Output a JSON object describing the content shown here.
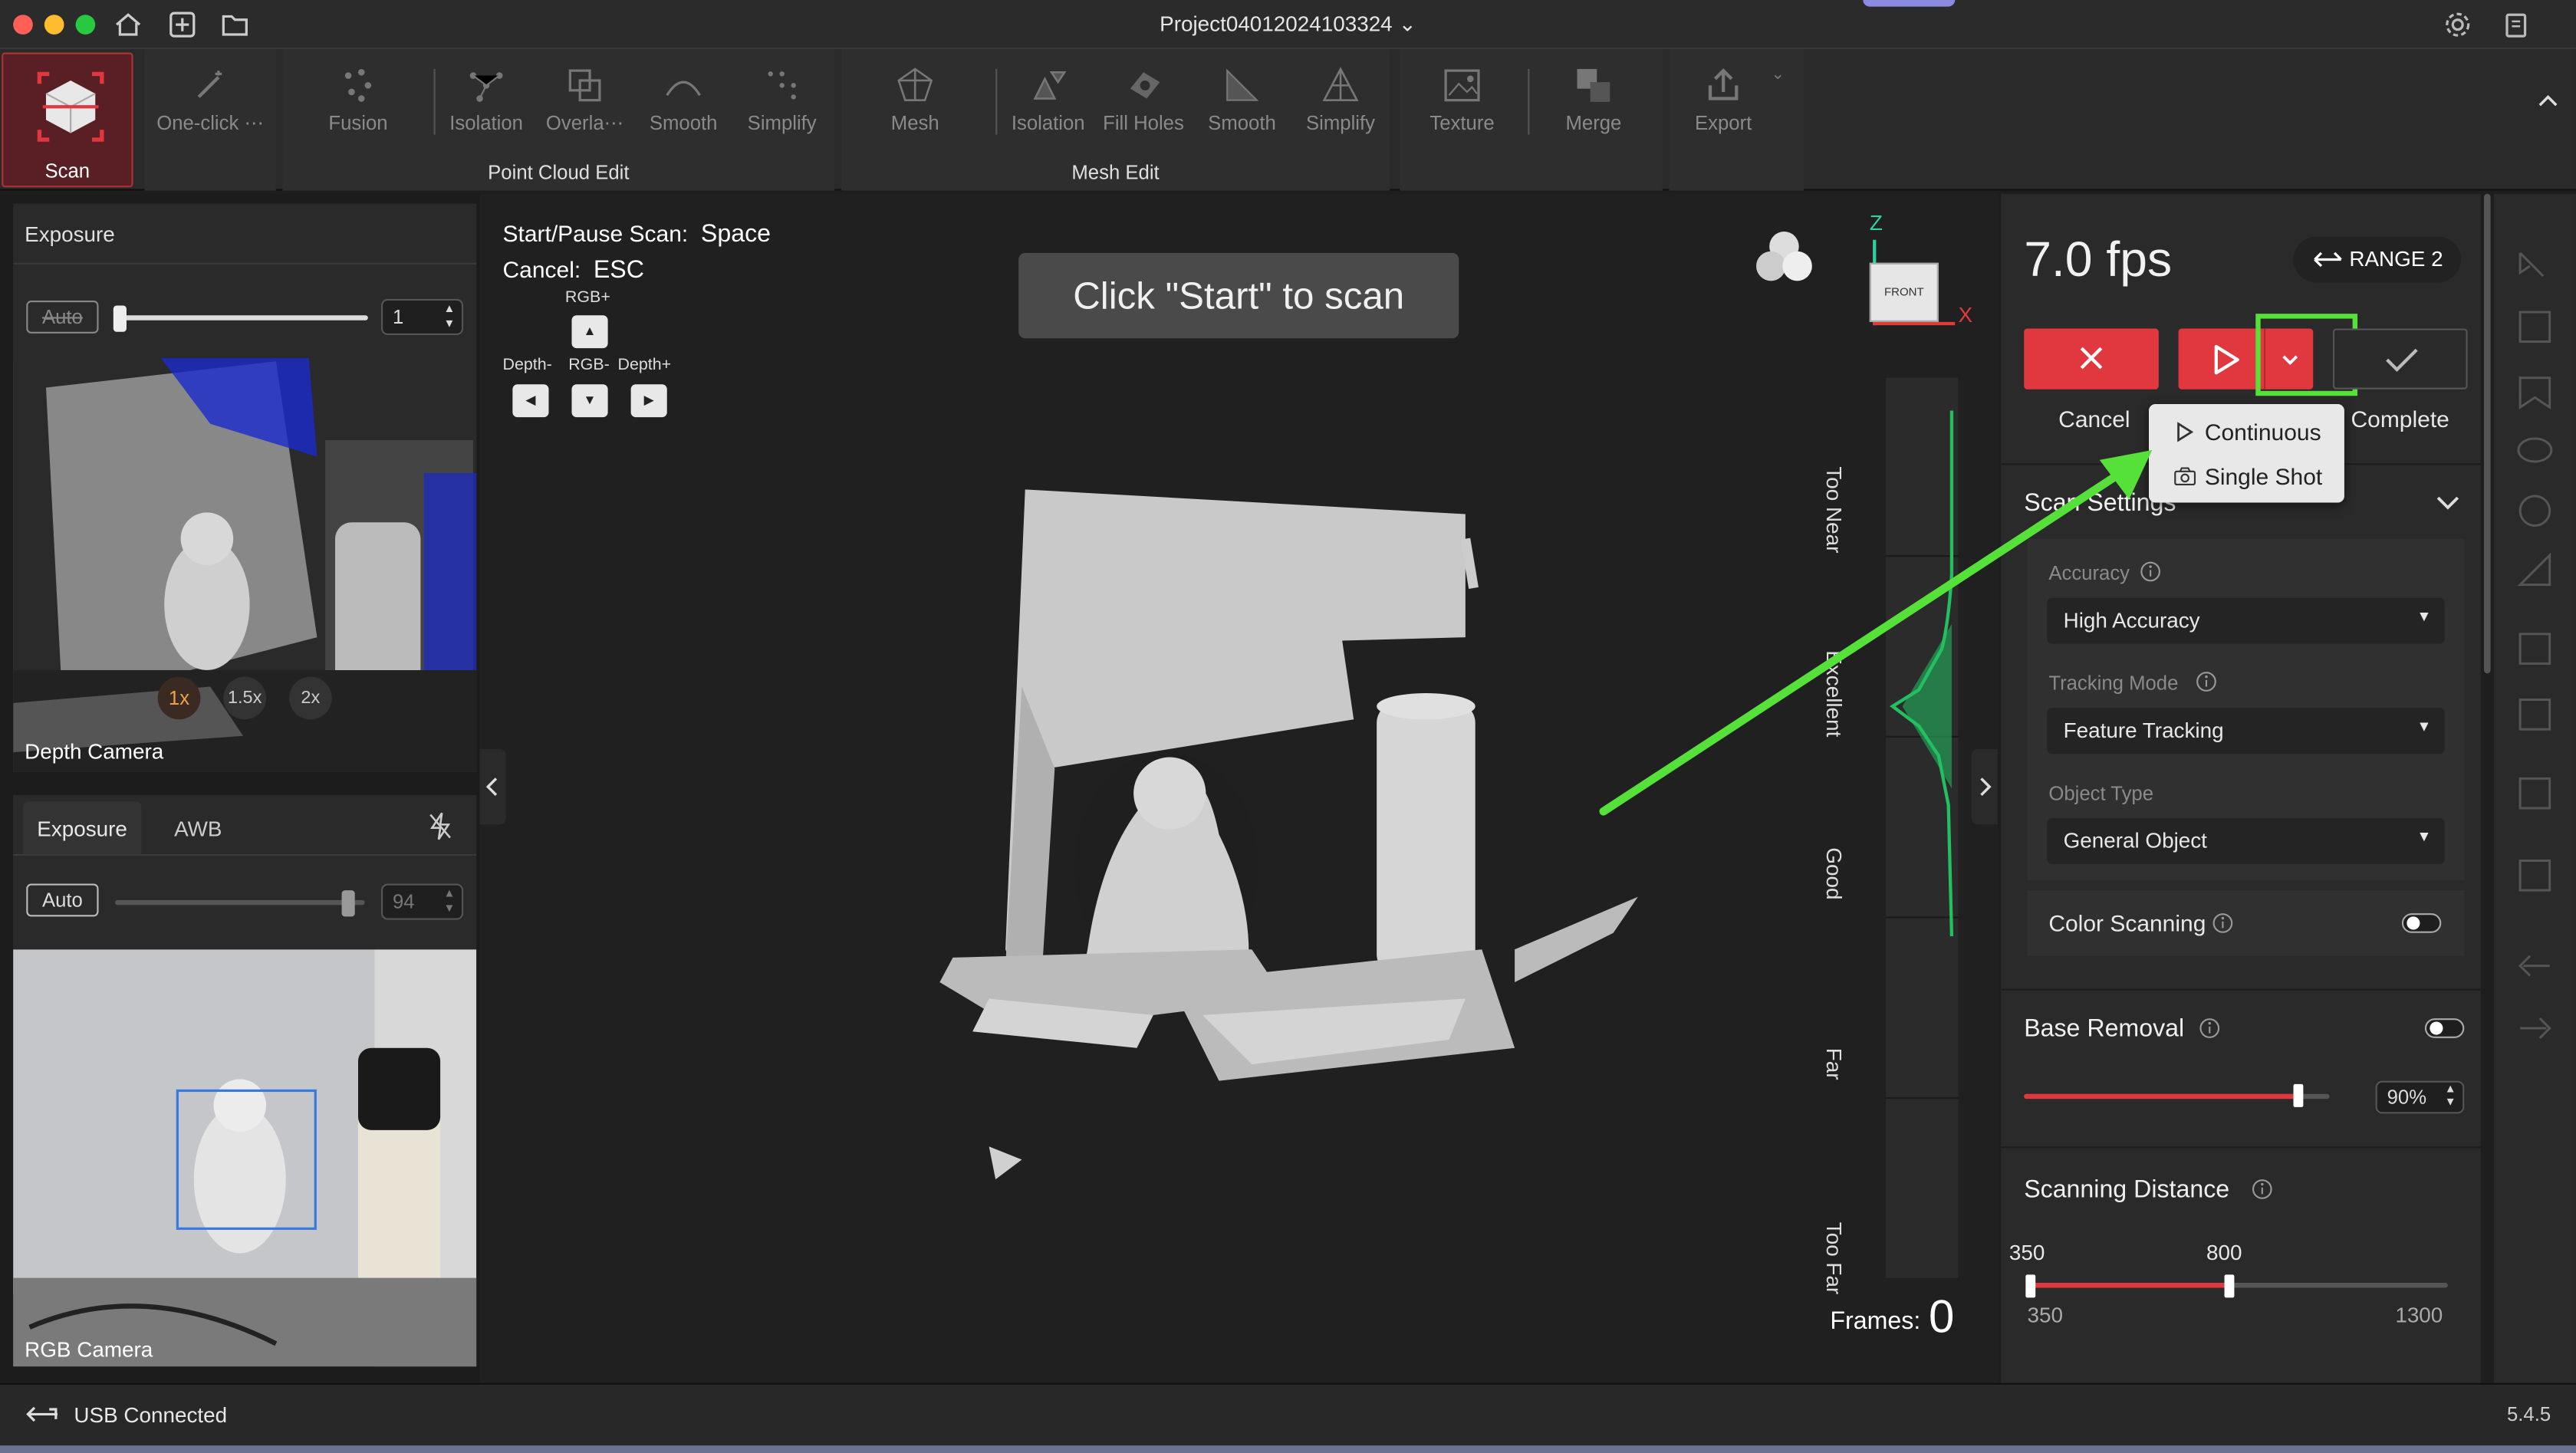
{
  "window": {
    "title": "Project04012024103324"
  },
  "toolbar": {
    "scan": "Scan",
    "oneclick": "One-click ⋯",
    "pc_tools": [
      "Fusion",
      "Isolation",
      "Overla⋯",
      "Smooth",
      "Simplify"
    ],
    "pc_group": "Point Cloud Edit",
    "mesh_tools": [
      "Mesh",
      "Isolation",
      "Fill Holes",
      "Smooth",
      "Simplify"
    ],
    "mesh_group": "Mesh Edit",
    "texture": "Texture",
    "merge": "Merge",
    "export": "Export"
  },
  "left": {
    "depth": {
      "exposure_label": "Exposure",
      "auto": "Auto",
      "value": "1",
      "camera_label": "Depth Camera",
      "zoom": [
        "1x",
        "1.5x",
        "2x"
      ],
      "slider_fraction": 0.0
    },
    "rgb": {
      "tabs": [
        "Exposure",
        "AWB"
      ],
      "auto": "Auto",
      "value": "94",
      "camera_label": "RGB Camera",
      "slider_fraction": 0.93
    }
  },
  "viewport": {
    "hint_start_key": "Start/Pause Scan:",
    "hint_start_val": "Space",
    "hint_cancel_key": "Cancel:",
    "hint_cancel_val": "ESC",
    "keys": {
      "rgb_plus": "RGB+",
      "depth_minus": "Depth-",
      "rgb_minus": "RGB-",
      "depth_plus": "Depth+"
    },
    "banner": "Click \"Start\" to scan",
    "axis": {
      "z": "Z",
      "x": "X",
      "cube": "FRONT"
    },
    "distance_labels": [
      "Too Near",
      "Excellent",
      "Good",
      "Far",
      "Too Far"
    ],
    "frames_label": "Frames:",
    "frames_value": "0"
  },
  "right": {
    "fps": "7.0 fps",
    "range": "RANGE 2",
    "cancel": "Cancel",
    "complete": "Complete",
    "dropdown": [
      "Continuous",
      "Single Shot"
    ],
    "scan_settings": "Scan Settings",
    "accuracy_label": "Accuracy",
    "accuracy_value": "High Accuracy",
    "tracking_label": "Tracking Mode",
    "tracking_value": "Feature Tracking",
    "object_label": "Object Type",
    "object_value": "General Object",
    "color_scanning": "Color Scanning",
    "base_removal": "Base Removal",
    "base_value": "90%",
    "base_fraction": 0.9,
    "scan_distance": "Scanning Distance",
    "dist_low": "350",
    "dist_high": "800",
    "dist_min": "350",
    "dist_max": "1300"
  },
  "status": {
    "usb": "USB Connected",
    "version": "5.4.5"
  },
  "colors": {
    "accent_red": "#e0383e",
    "highlight_green": "#55e03a",
    "active_scan": "#7a2a30"
  }
}
